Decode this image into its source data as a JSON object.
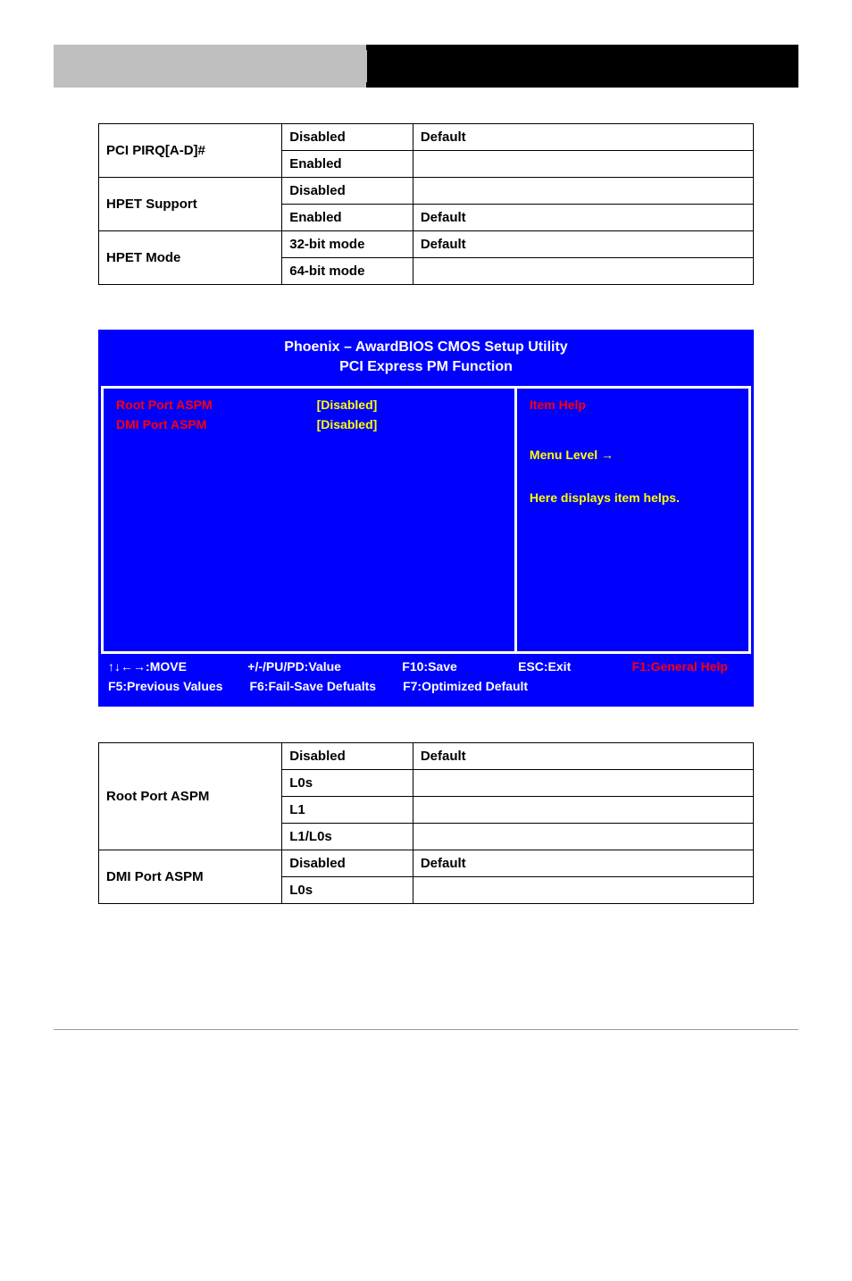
{
  "optionsTable1": {
    "rows": [
      {
        "name": "PCI PIRQ[A-D]#",
        "value": "Disabled",
        "def": "Default"
      },
      {
        "name": "",
        "value": "Enabled",
        "def": ""
      },
      {
        "name": "HPET Support",
        "value": "Disabled",
        "def": ""
      },
      {
        "name": "",
        "value": "Enabled",
        "def": "Default"
      },
      {
        "name": "HPET Mode",
        "value": "32-bit mode",
        "def": "Default"
      },
      {
        "name": "",
        "value": "64-bit mode",
        "def": ""
      }
    ]
  },
  "bios": {
    "titleLine1": "Phoenix – AwardBIOS CMOS Setup Utility",
    "titleLine2": "PCI Express PM Function",
    "items": [
      {
        "label": "Root Port ASPM",
        "value": "[Disabled]"
      },
      {
        "label": "DMI Port ASPM",
        "value": "[Disabled]"
      }
    ],
    "help": {
      "title": "Item Help",
      "menuLevel": "Menu Level   →",
      "desc": "Here displays item helps."
    },
    "footer": {
      "row1": {
        "move": "↑↓←→:MOVE",
        "value": "+/-/PU/PD:Value",
        "save": "F10:Save",
        "exit": "ESC:Exit",
        "help": "F1:General Help"
      },
      "row2": {
        "prev": "F5:Previous Values",
        "fail": "F6:Fail-Save Defualts",
        "opt": "F7:Optimized Default"
      }
    }
  },
  "optionsTable2": {
    "rows": [
      {
        "name": "Root Port ASPM",
        "value": "Disabled",
        "def": "Default"
      },
      {
        "name": "",
        "value": "L0s",
        "def": ""
      },
      {
        "name": "",
        "value": "L1",
        "def": ""
      },
      {
        "name": "",
        "value": "L1/L0s",
        "def": ""
      },
      {
        "name": "DMI Port ASPM",
        "value": "Disabled",
        "def": "Default"
      },
      {
        "name": "",
        "value": "L0s",
        "def": ""
      }
    ]
  }
}
